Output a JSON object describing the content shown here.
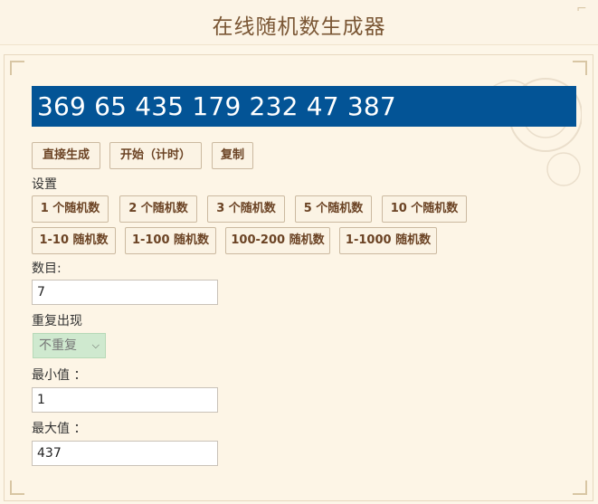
{
  "header": {
    "title": "在线随机数生成器"
  },
  "result": {
    "text": "369 65 435 179 232 47 387"
  },
  "actions": {
    "direct": "直接生成",
    "start": "开始（计时）",
    "copy": "复制"
  },
  "settings": {
    "label": "设置",
    "presets_row1": [
      "1 个随机数",
      "2 个随机数",
      "3 个随机数",
      "5 个随机数",
      "10 个随机数"
    ],
    "presets_row2": [
      "1-10 随机数",
      "1-100 随机数",
      "100-200 随机数",
      "1-1000 随机数"
    ]
  },
  "fields": {
    "count_label": "数目:",
    "count_value": "7",
    "repeat_label": "重复出现",
    "repeat_value": "不重复",
    "min_label": "最小值  ：",
    "min_value": "1",
    "max_label": "最大值  ：",
    "max_value": "437"
  },
  "colors": {
    "result_bg": "#035496",
    "button_text": "#6b4324",
    "title": "#7a5634"
  }
}
